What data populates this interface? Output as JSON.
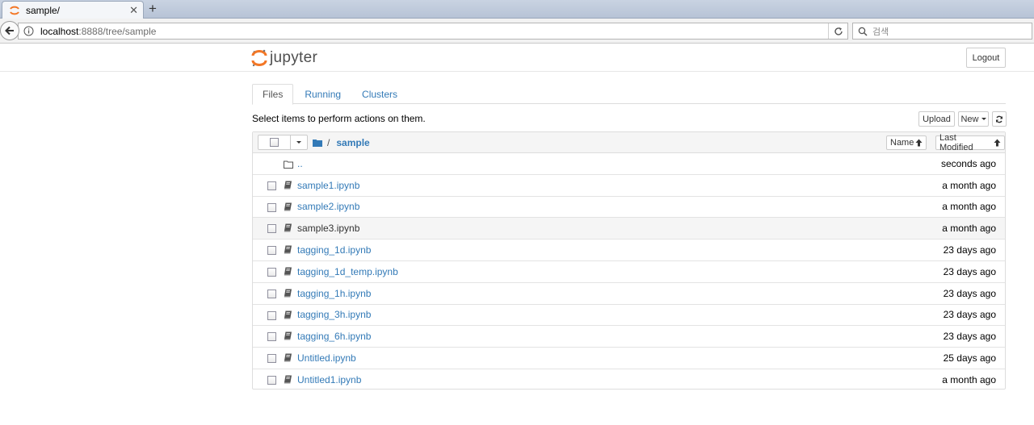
{
  "browser": {
    "tab_title": "sample/",
    "new_tab_symbol": "+",
    "close_symbol": "✕",
    "url_host": "localhost",
    "url_path": ":8888/tree/sample",
    "search_placeholder": "검색"
  },
  "header": {
    "logo_text": "jupyter",
    "logout_label": "Logout"
  },
  "tabs": [
    {
      "label": "Files",
      "active": true
    },
    {
      "label": "Running",
      "active": false
    },
    {
      "label": "Clusters",
      "active": false
    }
  ],
  "toolbar": {
    "hint": "Select items to perform actions on them.",
    "upload_label": "Upload",
    "new_label": "New"
  },
  "list": {
    "breadcrumb_sep": "/",
    "breadcrumb_folder": "sample",
    "sort_name_label": "Name",
    "sort_modified_label": "Last Modified",
    "parent": {
      "name": "..",
      "modified": "seconds ago"
    },
    "files": [
      {
        "name": "sample1.ipynb",
        "modified": "a month ago"
      },
      {
        "name": "sample2.ipynb",
        "modified": "a month ago"
      },
      {
        "name": "sample3.ipynb",
        "modified": "a month ago"
      },
      {
        "name": "tagging_1d.ipynb",
        "modified": "23 days ago"
      },
      {
        "name": "tagging_1d_temp.ipynb",
        "modified": "23 days ago"
      },
      {
        "name": "tagging_1h.ipynb",
        "modified": "23 days ago"
      },
      {
        "name": "tagging_3h.ipynb",
        "modified": "23 days ago"
      },
      {
        "name": "tagging_6h.ipynb",
        "modified": "23 days ago"
      },
      {
        "name": "Untitled.ipynb",
        "modified": "25 days ago"
      },
      {
        "name": "Untitled1.ipynb",
        "modified": "a month ago"
      }
    ]
  },
  "colors": {
    "link": "#337ab7",
    "jupyter_orange": "#f37726"
  }
}
